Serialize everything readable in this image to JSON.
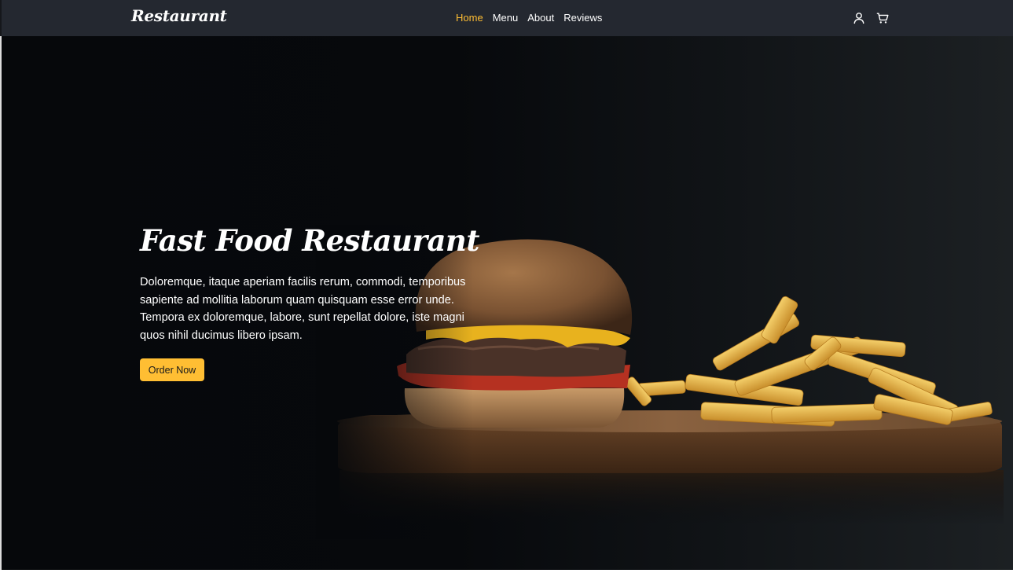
{
  "navbar": {
    "brand": "Restaurant",
    "links": [
      {
        "label": "Home",
        "active": true
      },
      {
        "label": "Menu",
        "active": false
      },
      {
        "label": "About",
        "active": false
      },
      {
        "label": "Reviews",
        "active": false
      }
    ],
    "icons": [
      "user-icon",
      "cart-icon"
    ]
  },
  "hero": {
    "title": "Fast Food Restaurant",
    "description": "Doloremque, itaque aperiam facilis rerum, commodi, temporibus sapiente ad mollitia laborum quam quisquam esse error unde. Tempora ex doloremque, labore, sunt repellat dolore, iste magni quos nihil ducimus libero ipsam.",
    "button_label": "Order Now",
    "image": "burger-and-fries-on-wooden-board"
  },
  "colors": {
    "accent": "#ffbe33",
    "navbar_bg": "#242830",
    "hero_bg": "#06080b",
    "text": "#ffffff"
  }
}
